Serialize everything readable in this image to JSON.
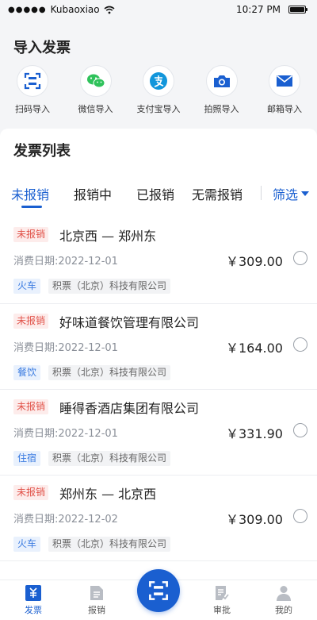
{
  "status_bar": {
    "carrier": "Kubaoxiao",
    "time": "10:27 PM"
  },
  "import_section": {
    "title": "导入发票",
    "items": [
      {
        "label": "扫码导入",
        "icon": "scan-icon"
      },
      {
        "label": "微信导入",
        "icon": "wechat-icon"
      },
      {
        "label": "支付宝导入",
        "icon": "alipay-icon"
      },
      {
        "label": "拍照导入",
        "icon": "camera-icon"
      },
      {
        "label": "邮箱导入",
        "icon": "mail-icon"
      }
    ]
  },
  "invoice_list": {
    "title": "发票列表",
    "tabs": [
      {
        "label": "未报销",
        "active": true
      },
      {
        "label": "报销中",
        "active": false
      },
      {
        "label": "已报销",
        "active": false
      },
      {
        "label": "无需报销",
        "active": false
      }
    ],
    "filter_label": "筛选",
    "items": [
      {
        "status": "未报销",
        "title": "北京西 — 郑州东",
        "date": "消费日期:2022-12-01",
        "amount": "￥309.00",
        "category": "火车",
        "company": "积票（北京）科技有限公司"
      },
      {
        "status": "未报销",
        "title": "好味道餐饮管理有限公司",
        "date": "消费日期:2022-12-01",
        "amount": "￥164.00",
        "category": "餐饮",
        "company": "积票（北京）科技有限公司"
      },
      {
        "status": "未报销",
        "title": "睡得香酒店集团有限公司",
        "date": "消费日期:2022-12-01",
        "amount": "￥331.90",
        "category": "住宿",
        "company": "积票（北京）科技有限公司"
      },
      {
        "status": "未报销",
        "title": "郑州东 — 北京西",
        "date": "消费日期:2022-12-02",
        "amount": "￥309.00",
        "category": "火车",
        "company": "积票（北京）科技有限公司"
      }
    ]
  },
  "bottom_nav": {
    "items": [
      {
        "label": "发票",
        "icon": "invoice-icon",
        "active": true
      },
      {
        "label": "报销",
        "icon": "reimburse-icon",
        "active": false
      },
      {
        "label": "审批",
        "icon": "approve-icon",
        "active": false
      },
      {
        "label": "我的",
        "icon": "user-icon",
        "active": false
      }
    ],
    "center_icon": "scan-icon"
  },
  "colors": {
    "accent": "#1a5fd0",
    "status_red": "#e1534a",
    "category_blue": "#3a7be0",
    "wechat_green": "#2fc25b",
    "alipay_blue": "#1296db"
  }
}
